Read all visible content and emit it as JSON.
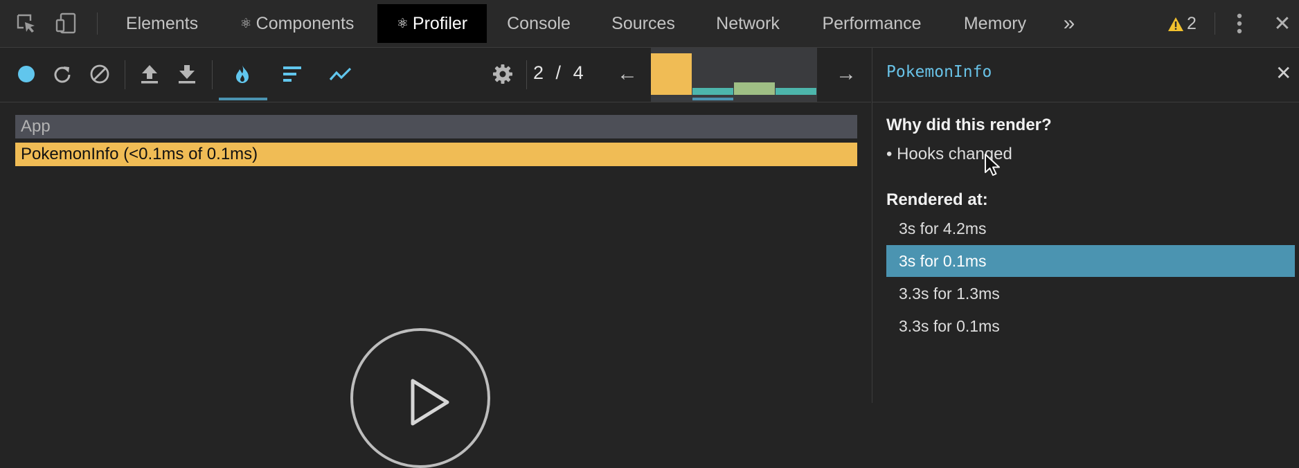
{
  "devtools": {
    "tabs": [
      {
        "label": "Elements",
        "icon": ""
      },
      {
        "label": "Components",
        "icon": "⚛"
      },
      {
        "label": "Profiler",
        "icon": "⚛",
        "active": true
      },
      {
        "label": "Console",
        "icon": ""
      },
      {
        "label": "Sources",
        "icon": ""
      },
      {
        "label": "Network",
        "icon": ""
      },
      {
        "label": "Performance",
        "icon": ""
      },
      {
        "label": "Memory",
        "icon": ""
      }
    ],
    "more_tabs_glyph": "»",
    "warning_count": "2",
    "close_glyph": "✕"
  },
  "toolbar": {
    "icons": [
      "record-icon",
      "reload-and-profile-icon",
      "clear-icon",
      "load-profile-icon",
      "save-profile-icon",
      "flamegraph-icon",
      "ranked-chart-icon",
      "timeline-icon",
      "settings-icon"
    ],
    "commit_index": "2",
    "commit_separator": "/",
    "commit_total": "4",
    "prev_glyph": "←",
    "next_glyph": "→",
    "commits": [
      {
        "height_fraction": 1.0,
        "color": "#f0bc55",
        "selected": true
      },
      {
        "height_fraction": 0.16,
        "color": "#4db6ac",
        "selected": false
      },
      {
        "height_fraction": 0.3,
        "color": "#9fbf85",
        "selected": false
      },
      {
        "height_fraction": 0.16,
        "color": "#4db6ac",
        "selected": false
      }
    ]
  },
  "flamegraph": {
    "rows": [
      {
        "label": "App",
        "color": "#4d4f57",
        "text_color": "#b3b3b3"
      },
      {
        "label": "PokemonInfo (<0.1ms of 0.1ms)",
        "color": "#f0bc55",
        "text_color": "#111111"
      }
    ]
  },
  "sidebar": {
    "title": "PokemonInfo",
    "close_glyph": "✕",
    "why_heading": "Why did this render?",
    "why_items": [
      "• Hooks changed"
    ],
    "rendered_heading": "Rendered at:",
    "renders": [
      {
        "label": "3s for 4.2ms",
        "selected": false
      },
      {
        "label": "3s for 0.1ms",
        "selected": true
      },
      {
        "label": "3.3s for 1.3ms",
        "selected": false
      },
      {
        "label": "3.3s for 0.1ms",
        "selected": false
      }
    ]
  },
  "colors": {
    "accent": "#4b94b1",
    "highlight": "#f0bc55",
    "title_blue": "#69c3e8"
  }
}
